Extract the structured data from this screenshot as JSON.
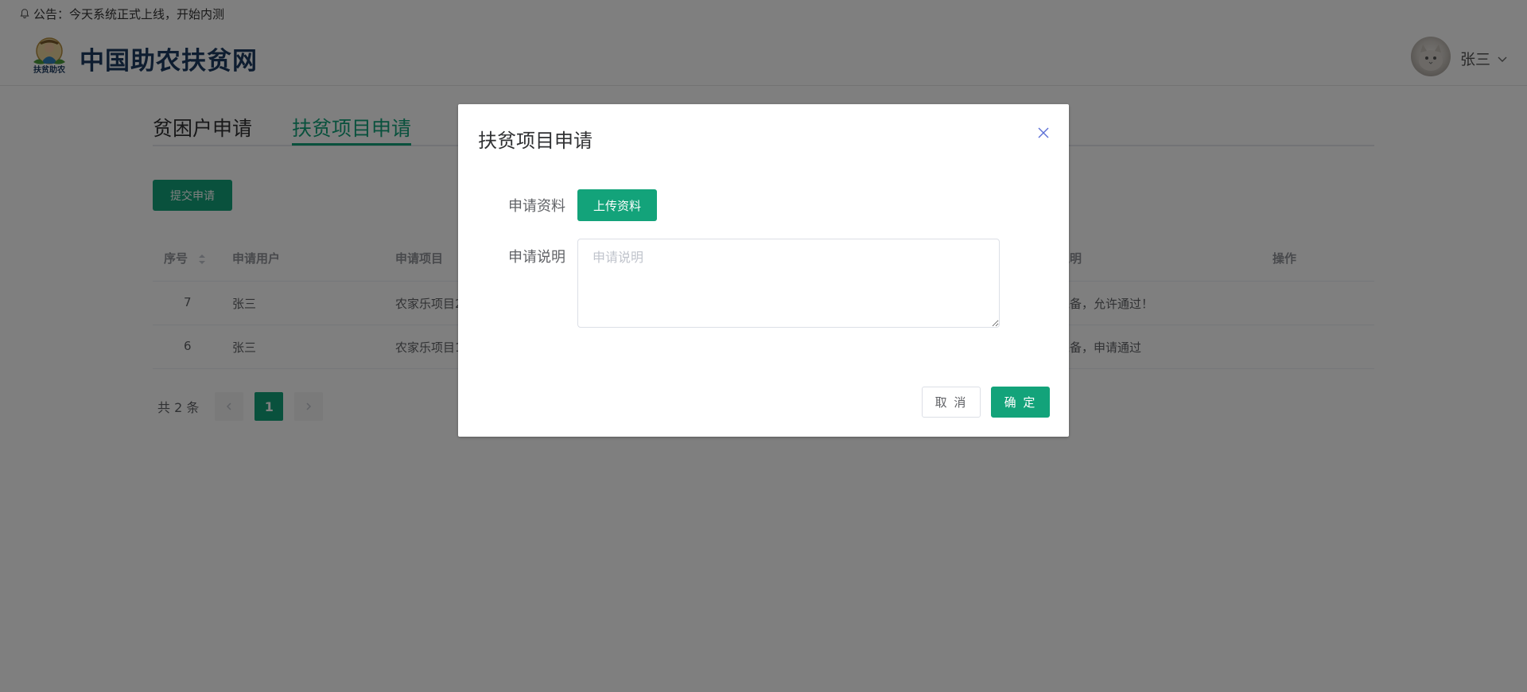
{
  "announcement": {
    "text": "公告：今天系统正式上线，开始内测"
  },
  "header": {
    "site_title": "中国助农扶贫网",
    "logo_text": "扶贫助农",
    "username": "张三"
  },
  "tabs": [
    {
      "label": "贫困户申请"
    },
    {
      "label": "扶贫项目申请"
    }
  ],
  "toolbar": {
    "submit_label": "提交申请"
  },
  "table": {
    "columns": [
      "序号",
      "申请用户",
      "申请项目",
      "说明",
      "操作"
    ],
    "rows": [
      {
        "id": "7",
        "user": "张三",
        "project": "农家乐项目2",
        "note": "完备，允许通过！"
      },
      {
        "id": "6",
        "user": "张三",
        "project": "农家乐项目1",
        "note": "完备，申请通过"
      }
    ]
  },
  "pagination": {
    "total_label": "共 2 条",
    "current_page": "1"
  },
  "dialog": {
    "title": "扶贫项目申请",
    "label_material": "申请资料",
    "upload_label": "上传资料",
    "label_desc": "申请说明",
    "desc_placeholder": "申请说明",
    "cancel_label": "取 消",
    "ok_label": "确 定"
  },
  "colors": {
    "accent": "#13a37a",
    "title": "#1d3b60"
  }
}
